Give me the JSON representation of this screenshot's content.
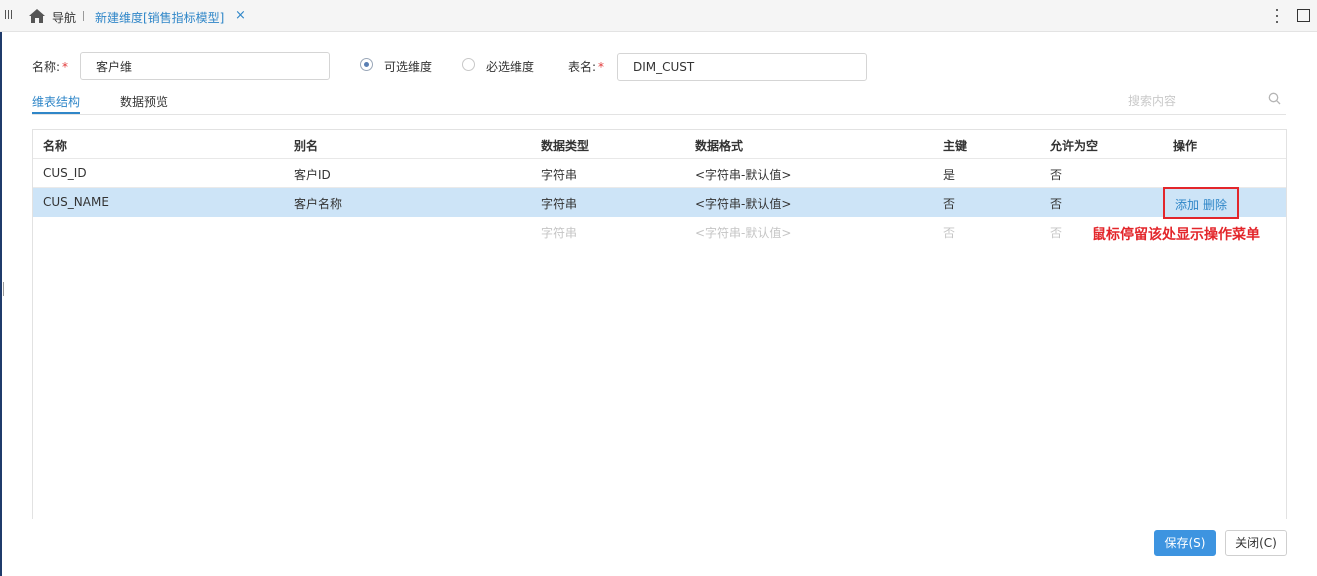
{
  "topbar": {
    "nav_label": "导航",
    "tab_title": "新建维度[销售指标模型]",
    "tab_close": "×"
  },
  "form": {
    "name_label": "名称:",
    "name_value": "客户维",
    "required_mark": "*",
    "radio_optional": "可选维度",
    "radio_required": "必选维度",
    "radio_selected": "可选维度",
    "table_label": "表名:",
    "table_value": "DIM_CUST"
  },
  "subtabs": {
    "structure": "维表结构",
    "preview": "数据预览",
    "active": "维表结构"
  },
  "search": {
    "placeholder": "搜索内容"
  },
  "table": {
    "headers": [
      "名称",
      "别名",
      "数据类型",
      "数据格式",
      "主键",
      "允许为空",
      "操作"
    ],
    "rows": [
      [
        "CUS_ID",
        "客户ID",
        "字符串",
        "<字符串-默认值>",
        "是",
        "否"
      ],
      [
        "CUS_NAME",
        "客户名称",
        "字符串",
        "<字符串-默认值>",
        "否",
        "否"
      ],
      [
        "",
        "",
        "字符串",
        "<字符串-默认值>",
        "否",
        "否"
      ]
    ],
    "actions": {
      "add": "添加",
      "delete": "删除"
    }
  },
  "annotation": "鼠标停留该处显示操作菜单",
  "buttons": {
    "save": "保存(S)",
    "close": "关闭(C)"
  }
}
